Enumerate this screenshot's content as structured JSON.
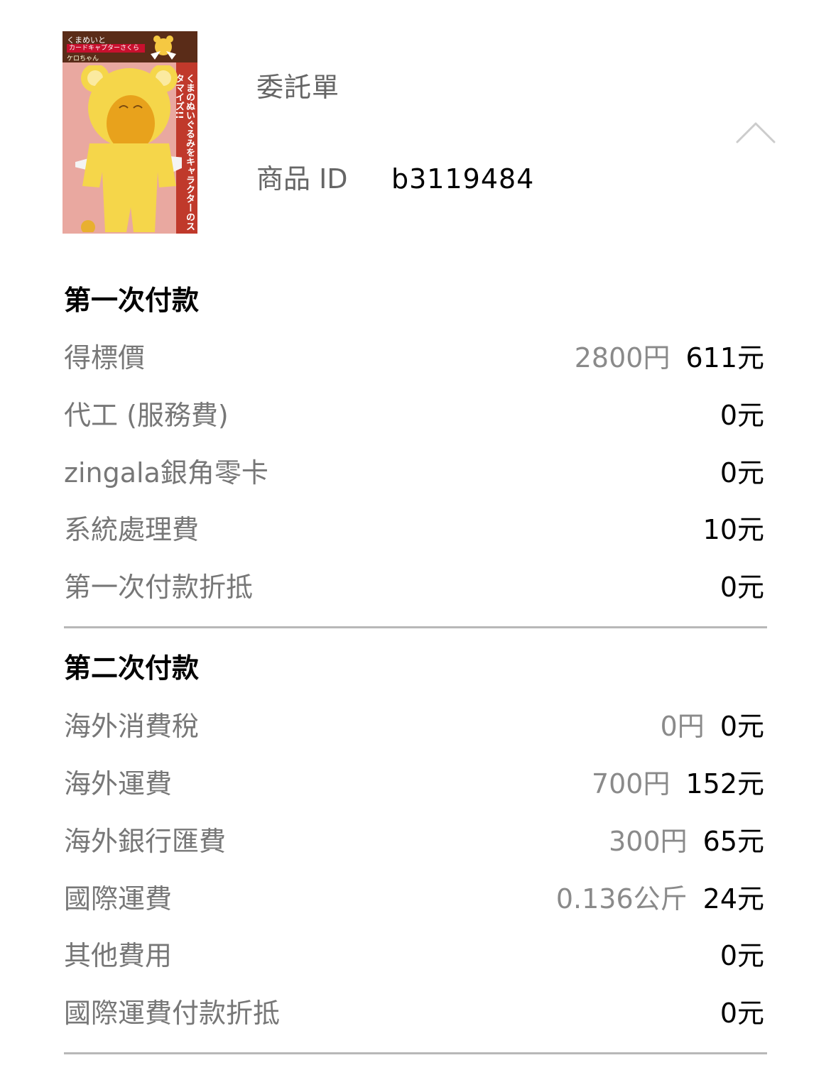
{
  "header": {
    "title": "委託單",
    "id_label": "商品 ID",
    "id_value": "b3119484",
    "thumb_brand": "くまめいと",
    "thumb_series": "カードキャプターさくら",
    "thumb_name": "ケロちゃん",
    "thumb_side_text": "くまのぬいぐるみをキャラクターのスタマイズ!!"
  },
  "first_payment": {
    "title": "第一次付款",
    "rows": [
      {
        "label": "得標價",
        "orig": "2800円",
        "amount": "611元"
      },
      {
        "label": "代工 (服務費)",
        "orig": "",
        "amount": "0元"
      },
      {
        "label": "zingala銀角零卡",
        "orig": "",
        "amount": "0元"
      },
      {
        "label": "系統處理費",
        "orig": "",
        "amount": "10元"
      },
      {
        "label": "第一次付款折抵",
        "orig": "",
        "amount": "0元"
      }
    ]
  },
  "second_payment": {
    "title": "第二次付款",
    "rows": [
      {
        "label": "海外消費稅",
        "orig": "0円",
        "amount": "0元"
      },
      {
        "label": "海外運費",
        "orig": "700円",
        "amount": "152元"
      },
      {
        "label": "海外銀行匯費",
        "orig": "300円",
        "amount": "65元"
      },
      {
        "label": "國際運費",
        "orig": "0.136公斤",
        "amount": "24元"
      },
      {
        "label": "其他費用",
        "orig": "",
        "amount": "0元"
      },
      {
        "label": "國際運費付款折抵",
        "orig": "",
        "amount": "0元"
      }
    ]
  },
  "colors": {
    "label": "#777777",
    "muted": "#8a8a8a",
    "divider": "#b8b8b8",
    "thumb_bg": "#e9a8a0",
    "costume": "#f5d64a"
  },
  "icons": {
    "collapse": "chevron-up-icon"
  }
}
